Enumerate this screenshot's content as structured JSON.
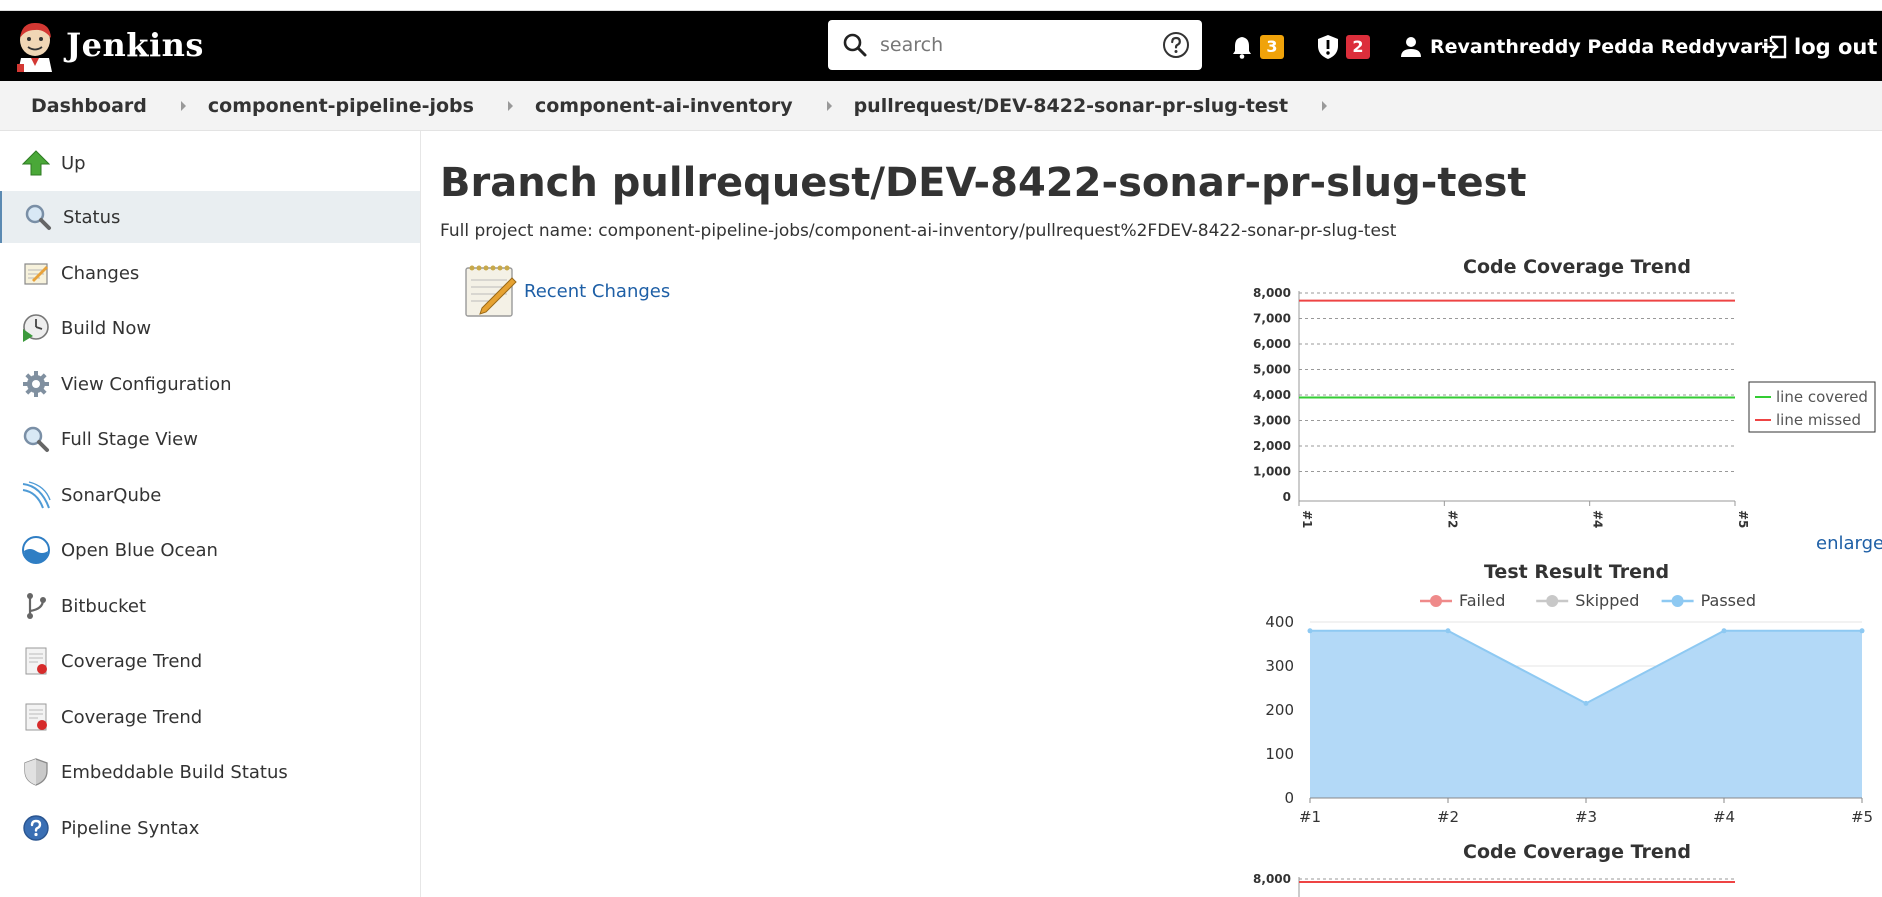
{
  "header": {
    "brand": "Jenkins",
    "search_placeholder": "search",
    "notifications_count": "3",
    "security_count": "2",
    "user_name": "Revanthreddy Pedda Reddyvari",
    "logout_label": "log out",
    "icons": [
      "jenkins-logo",
      "search-icon",
      "help-icon",
      "bell-icon",
      "shield-alert-icon",
      "user-icon",
      "logout-icon"
    ]
  },
  "breadcrumb": [
    "Dashboard",
    "component-pipeline-jobs",
    "component-ai-inventory",
    "pullrequest/DEV-8422-sonar-pr-slug-test"
  ],
  "sidebar": {
    "items": [
      {
        "label": "Up",
        "icon": "up-arrow-icon"
      },
      {
        "label": "Status",
        "icon": "magnifier-icon",
        "active": true
      },
      {
        "label": "Changes",
        "icon": "notepad-icon"
      },
      {
        "label": "Build Now",
        "icon": "build-now-icon"
      },
      {
        "label": "View Configuration",
        "icon": "gear-icon"
      },
      {
        "label": "Full Stage View",
        "icon": "magnifier-icon"
      },
      {
        "label": "SonarQube",
        "icon": "sonarqube-icon"
      },
      {
        "label": "Open Blue Ocean",
        "icon": "blue-ocean-icon"
      },
      {
        "label": "Bitbucket",
        "icon": "bitbucket-icon"
      },
      {
        "label": "Coverage Trend",
        "icon": "coverage-report-icon"
      },
      {
        "label": "Coverage Trend",
        "icon": "coverage-report-icon"
      },
      {
        "label": "Embeddable Build Status",
        "icon": "shield-icon"
      },
      {
        "label": "Pipeline Syntax",
        "icon": "question-icon"
      }
    ]
  },
  "main": {
    "title": "Branch pullrequest/DEV-8422-sonar-pr-slug-test",
    "full_project_name": "Full project name: component-pipeline-jobs/component-ai-inventory/pullrequest%2FDEV-8422-sonar-pr-slug-test",
    "recent_changes_label": "Recent Changes",
    "enlarge_label": "enlarge"
  },
  "chart_data": [
    {
      "type": "line",
      "title": "Code Coverage Trend",
      "categories": [
        "#1",
        "#2",
        "#4",
        "#5"
      ],
      "series": [
        {
          "name": "line covered",
          "color": "#33cc33",
          "values": [
            3900,
            3900,
            3900,
            3900
          ]
        },
        {
          "name": "line missed",
          "color": "#ee4444",
          "values": [
            7700,
            7700,
            7700,
            7700
          ]
        }
      ],
      "ylim": [
        0,
        8000
      ],
      "yticks": [
        "0",
        "1,000",
        "2,000",
        "3,000",
        "4,000",
        "5,000",
        "6,000",
        "7,000",
        "8,000"
      ],
      "grid": true,
      "legend": "right"
    },
    {
      "type": "area",
      "title": "Test Result Trend",
      "categories": [
        "#1",
        "#2",
        "#3",
        "#4",
        "#5"
      ],
      "legend": [
        "Failed",
        "Skipped",
        "Passed"
      ],
      "legend_colors": [
        "#ef8a8a",
        "#c8c8c8",
        "#8ec9f2"
      ],
      "series": [
        {
          "name": "Failed",
          "values": [
            0,
            0,
            0,
            0,
            0
          ]
        },
        {
          "name": "Skipped",
          "values": [
            0,
            0,
            0,
            0,
            0
          ]
        },
        {
          "name": "Passed",
          "values": [
            380,
            380,
            215,
            380,
            380
          ]
        }
      ],
      "ylim": [
        0,
        400
      ],
      "yticks": [
        "0",
        "100",
        "200",
        "300",
        "400"
      ],
      "grid": true
    },
    {
      "type": "line",
      "title": "Code Coverage Trend",
      "yticks": [
        "8,000"
      ],
      "series": [
        {
          "name": "line missed",
          "color": "#ee4444",
          "values": [
            7700,
            7700,
            7700,
            7700
          ]
        }
      ],
      "ylim": [
        0,
        8000
      ]
    }
  ]
}
